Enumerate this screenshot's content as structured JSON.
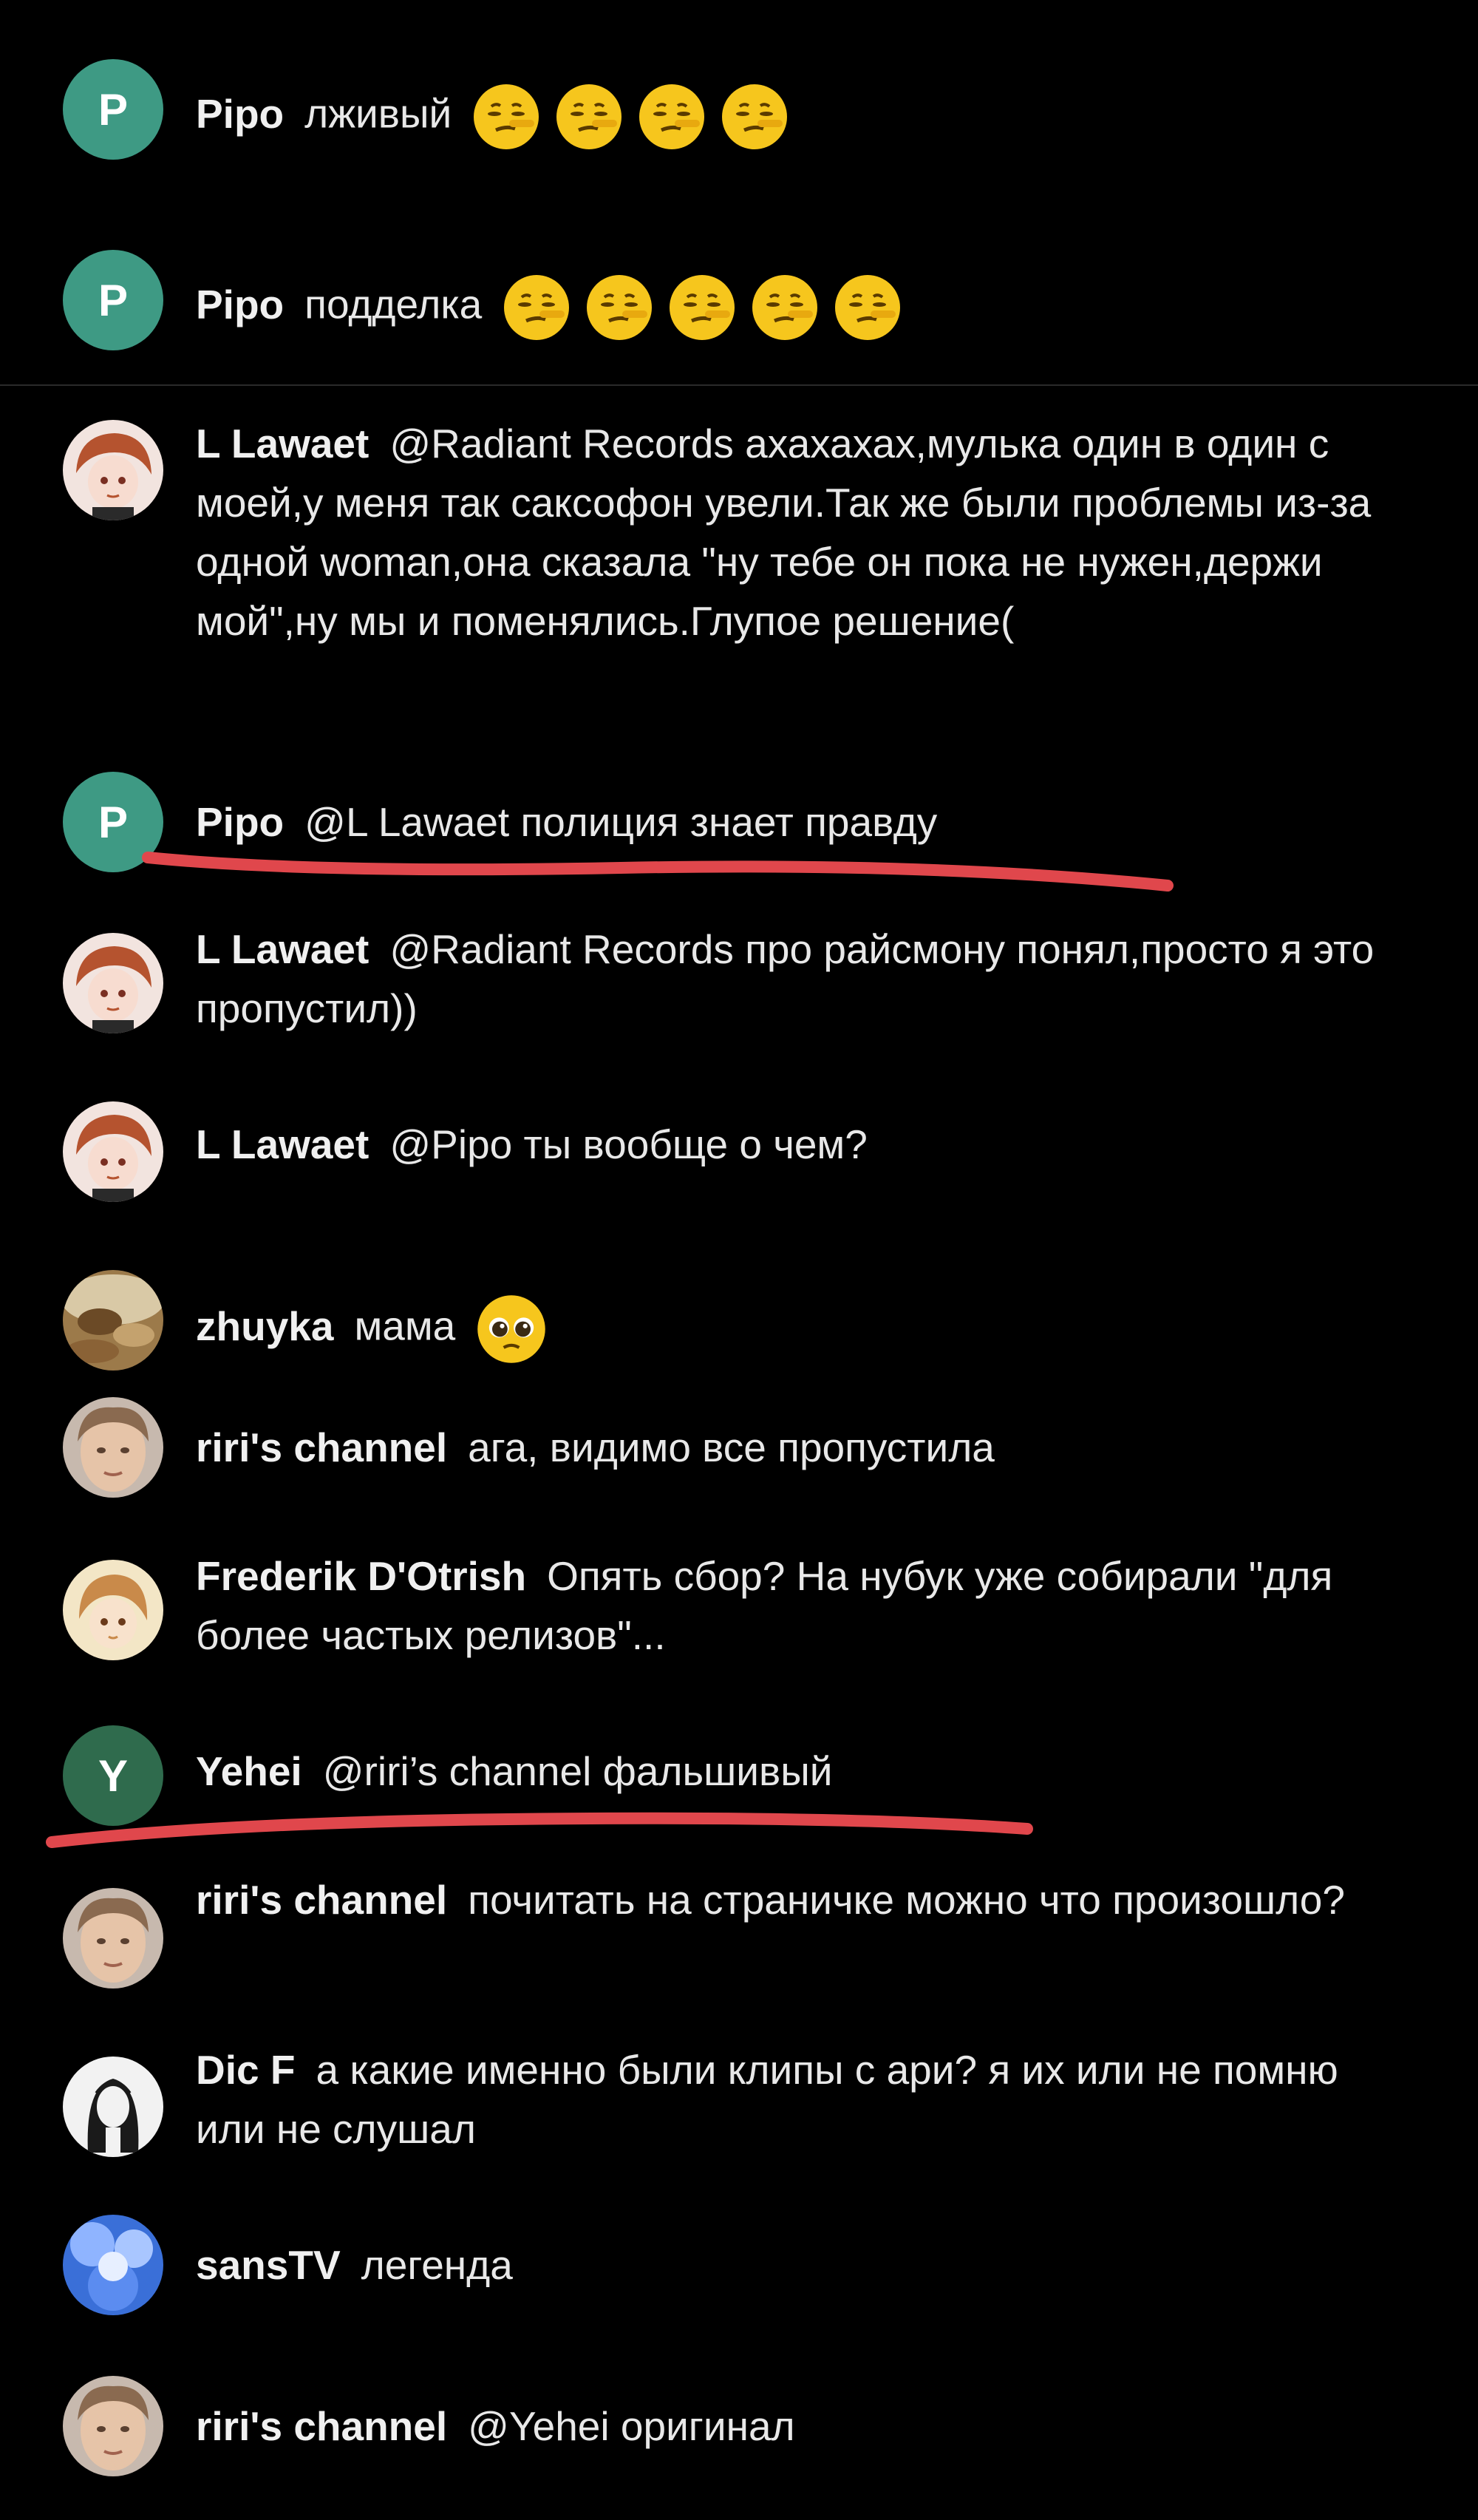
{
  "comments": [
    {
      "author": "Pipo",
      "text": "лживый",
      "avatar_letter": "P",
      "avatar_color": "#3e9a84",
      "emoji": "lying-face-emoji",
      "emoji_count": 4
    },
    {
      "author": "Pipo",
      "text": "подделка",
      "avatar_letter": "P",
      "avatar_color": "#3e9a84",
      "emoji": "lying-face-emoji",
      "emoji_count": 5
    },
    {
      "author": "L Lawaet",
      "text": "@Radiant Records ахахахах,мулька один в один с моей,у меня так саксофон увели.Так же были проблемы из-за одной woman,она сказала \"ну тебе он пока не нужен,держи мой\",ну мы и поменялись.Глупое решение(",
      "avatar": "anime-avatar"
    },
    {
      "author": "Pipo",
      "text": "@L Lawaet полиция знает правду",
      "avatar_letter": "P",
      "avatar_color": "#3e9a84",
      "underlined": true
    },
    {
      "author": "L Lawaet",
      "text": "@Radiant Records про райсмону понял,просто я это пропустил))",
      "avatar": "anime-avatar"
    },
    {
      "author": "L Lawaet",
      "text": "@Pipo ты вообще о чем?",
      "avatar": "anime-avatar"
    },
    {
      "author": "zhuyka",
      "text": "мама",
      "avatar": "photo-avatar",
      "emoji": "pleading-face-emoji",
      "emoji_count": 1
    },
    {
      "author": "riri's channel",
      "text": "ага, видимо все пропустила",
      "avatar": "face-avatar"
    },
    {
      "author": "Frederik D'Otrish",
      "text": "Опять сбор? На нубук уже собирали \"для более частых релизов\"...",
      "avatar": "anime-avatar-2"
    },
    {
      "author": "Yehei",
      "text": "@riri’s channel фальшивый",
      "avatar_letter": "Y",
      "avatar_color": "#2f6b4d",
      "underlined": true
    },
    {
      "author": "riri's channel",
      "text": "почитать на страничке можно что произошло?",
      "avatar": "face-avatar"
    },
    {
      "author": "Dic F",
      "text": "а какие именно были клипы с ари? я их или не помню или не слушал",
      "avatar": "sketch-avatar"
    },
    {
      "author": "sansTV",
      "text": "легенда",
      "avatar": "blue-avatar"
    },
    {
      "author": "riri's channel",
      "text": "@Yehei оригинал",
      "avatar": "face-avatar"
    }
  ],
  "colors": {
    "background": "#000000",
    "underline": "#e0474c"
  }
}
